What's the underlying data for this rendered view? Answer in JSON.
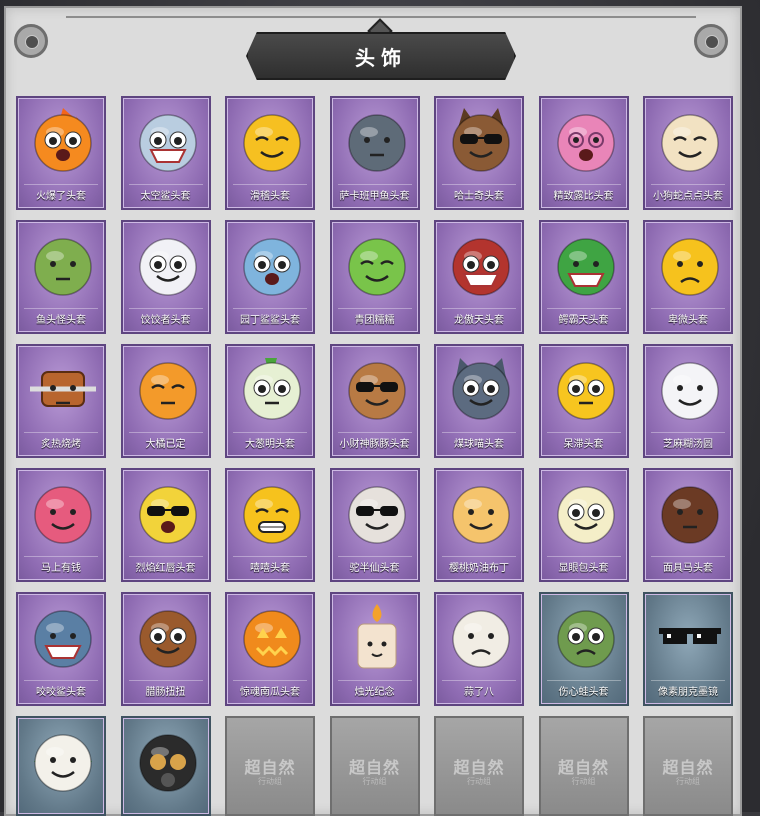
{
  "title": "头饰",
  "watermark": {
    "main": "超自然",
    "sub": "行动组"
  },
  "items": [
    {
      "label": "火爆了头套",
      "theme": "purple",
      "icon": "flame-face-icon"
    },
    {
      "label": "太空鲨头套",
      "theme": "purple",
      "icon": "shark-icon"
    },
    {
      "label": "滑稽头套",
      "theme": "purple",
      "icon": "funny-face-icon"
    },
    {
      "label": "萨卡班甲鱼头套",
      "theme": "purple",
      "icon": "fish-icon"
    },
    {
      "label": "哈士奇头套",
      "theme": "purple",
      "icon": "dog-sunglasses-icon"
    },
    {
      "label": "精致露比头套",
      "theme": "purple",
      "icon": "pink-beaver-icon"
    },
    {
      "label": "小狗蛇点点头套",
      "theme": "purple",
      "icon": "hamster-icon"
    },
    {
      "label": "鱼头怪头套",
      "theme": "purple",
      "icon": "green-fish-head-icon"
    },
    {
      "label": "饺饺者头套",
      "theme": "purple",
      "icon": "cloud-dumpling-icon"
    },
    {
      "label": "园丁鲨鲨头套",
      "theme": "purple",
      "icon": "blue-shark-icon"
    },
    {
      "label": "青团糯糯",
      "theme": "purple",
      "icon": "green-mochi-icon"
    },
    {
      "label": "龙傲天头套",
      "theme": "purple",
      "icon": "dragon-head-icon"
    },
    {
      "label": "鳄霸天头套",
      "theme": "purple",
      "icon": "crocodile-icon"
    },
    {
      "label": "卑微头套",
      "theme": "purple",
      "icon": "sad-face-icon"
    },
    {
      "label": "炙热烧烤",
      "theme": "purple",
      "icon": "bbq-icon"
    },
    {
      "label": "大橘已定",
      "theme": "purple",
      "icon": "orange-slice-icon"
    },
    {
      "label": "大葱明头套",
      "theme": "purple",
      "icon": "green-onion-icon"
    },
    {
      "label": "小财神豚豚头套",
      "theme": "purple",
      "icon": "capybara-icon"
    },
    {
      "label": "煤球喵头套",
      "theme": "purple",
      "icon": "gray-cat-icon"
    },
    {
      "label": "呆滞头套",
      "theme": "purple",
      "icon": "dull-face-icon"
    },
    {
      "label": "芝麻糊汤圆",
      "theme": "purple",
      "icon": "rice-ball-icon"
    },
    {
      "label": "马上有钱",
      "theme": "purple",
      "icon": "pink-horse-icon"
    },
    {
      "label": "烈焰红唇头套",
      "theme": "purple",
      "icon": "pikachu-icon"
    },
    {
      "label": "嘻嘻头套",
      "theme": "purple",
      "icon": "grin-face-icon"
    },
    {
      "label": "驼半仙头套",
      "theme": "purple",
      "icon": "alpaca-icon"
    },
    {
      "label": "樱桃奶油布丁",
      "theme": "purple",
      "icon": "pudding-icon"
    },
    {
      "label": "显眼包头套",
      "theme": "purple",
      "icon": "bulb-head-icon"
    },
    {
      "label": "面具马头套",
      "theme": "purple",
      "icon": "horse-mask-icon"
    },
    {
      "label": "咬咬鲨头套",
      "theme": "purple",
      "icon": "biting-shark-icon"
    },
    {
      "label": "腊肠扭扭",
      "theme": "purple",
      "icon": "dachshund-icon"
    },
    {
      "label": "惊魂南瓜头套",
      "theme": "purple",
      "icon": "pumpkin-icon"
    },
    {
      "label": "烛光纪念",
      "theme": "purple",
      "icon": "candle-icon"
    },
    {
      "label": "蒜了八",
      "theme": "purple",
      "icon": "garlic-icon"
    },
    {
      "label": "伤心蛙头套",
      "theme": "blue",
      "icon": "sad-frog-icon"
    },
    {
      "label": "像素朋克墨镜",
      "theme": "blue",
      "icon": "pixel-sunglasses-icon"
    }
  ],
  "last_row": [
    {
      "type": "owned",
      "theme": "blue",
      "icon": "watermelon-mochi-icon"
    },
    {
      "type": "owned",
      "theme": "blue",
      "icon": "gas-mask-helmet-icon"
    },
    {
      "type": "locked"
    },
    {
      "type": "locked"
    },
    {
      "type": "locked"
    },
    {
      "type": "locked"
    },
    {
      "type": "locked"
    }
  ]
}
